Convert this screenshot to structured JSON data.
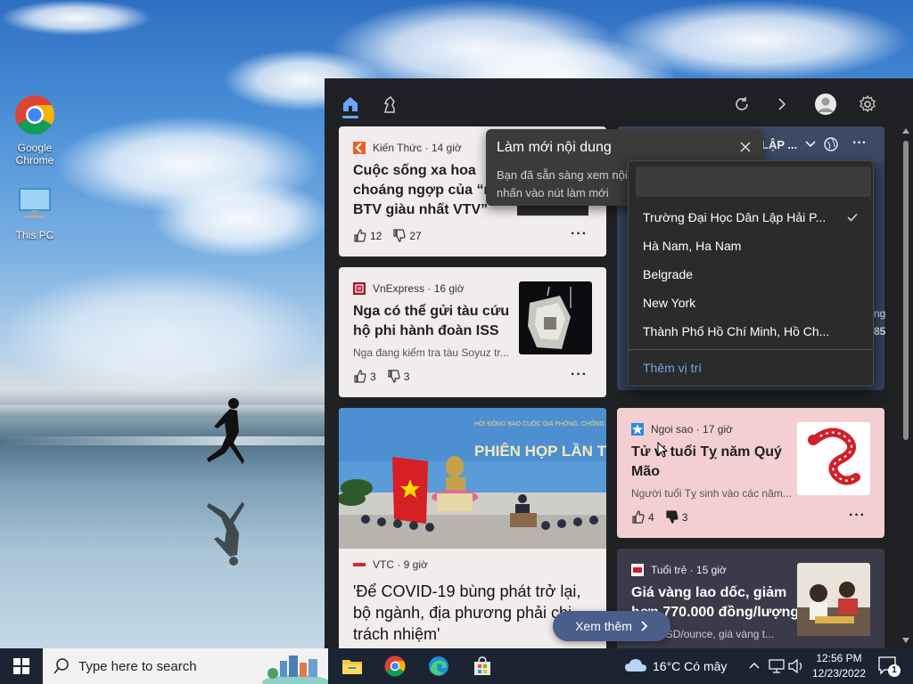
{
  "desktop": {
    "icons": [
      {
        "label": "Google Chrome"
      },
      {
        "label": "This PC"
      }
    ]
  },
  "panel": {
    "tooltip": {
      "title": "Làm mới nội dung",
      "body": "Bạn đã sẵn sàng xem nội dung mới? Hãy nhấn vào nút làm mới"
    },
    "weather_header_partial": "LẬP ...",
    "location_dropdown": {
      "items": [
        {
          "label": "Trường Đại Học Dân Lập Hải P...",
          "selected": true
        },
        {
          "label": "Hà Nam, Ha Nam",
          "selected": false
        },
        {
          "label": "Belgrade",
          "selected": false
        },
        {
          "label": "New York",
          "selected": false
        },
        {
          "label": "Thành Phố Hồ Chí Minh, Hồ Ch...",
          "selected": false
        }
      ],
      "add_label": "Thêm vị trí"
    },
    "weather_partial": {
      "line1": "ng",
      "line2": "85"
    },
    "cards": {
      "card1": {
        "source": "Kiến Thức · 14 giờ",
        "headline_lines": [
          "Cuộc sống xa hoa",
          "choáng ngợp của “nư",
          "BTV giàu nhất VTV”"
        ],
        "likes": "12",
        "dislikes": "27",
        "logo_color": "#e8632b"
      },
      "card2": {
        "source": "VnExpress · 16 giờ",
        "headline_lines": [
          "Nga có thể gửi tàu cứu",
          "hộ phi hành đoàn ISS"
        ],
        "snippet": "Nga đang kiểm tra tàu Soyuz tr...",
        "likes": "3",
        "dislikes": "3",
        "logo_color": "#a3182b"
      },
      "card3": {
        "source": "VTC · 9 giờ",
        "headline_lines": [
          "'Để COVID-19 bùng phát trở lại,",
          "bộ ngành, địa phương phải chị",
          "trách nhiệm'"
        ],
        "banner_text": "PHIÊN HỌP LẦN TH",
        "banner_small": "HỘI ĐỒNG BAO CUỘC GIA PHÒNG, CHỐNG DỊCH"
      },
      "card4": {
        "source": "Ngoi sao · 17 giờ",
        "headline_lines": [
          "Tử vi tuổi Tỵ năm Quý",
          "Mão"
        ],
        "snippet": "Người tuổi Tỵ sinh vào các năm...",
        "likes": "4",
        "dislikes": "3",
        "logo_color": "#2a8bd8"
      },
      "card5": {
        "source": "Tuổi trẻ · 15 giờ",
        "headline_lines": [
          "Giá vàng lao dốc, giảm",
          "hơn 770.000 đồng/lượng"
        ],
        "snippet": "... 50 USD/ounce, giá vàng t...",
        "logo_color": "#d01e2b"
      }
    },
    "see_more_label": "Xem thêm"
  },
  "taskbar": {
    "search_placeholder": "Type here to search",
    "weather": "16°C  Có mây",
    "time": "12:56 PM",
    "date": "12/23/2022",
    "notification_count": "1"
  }
}
